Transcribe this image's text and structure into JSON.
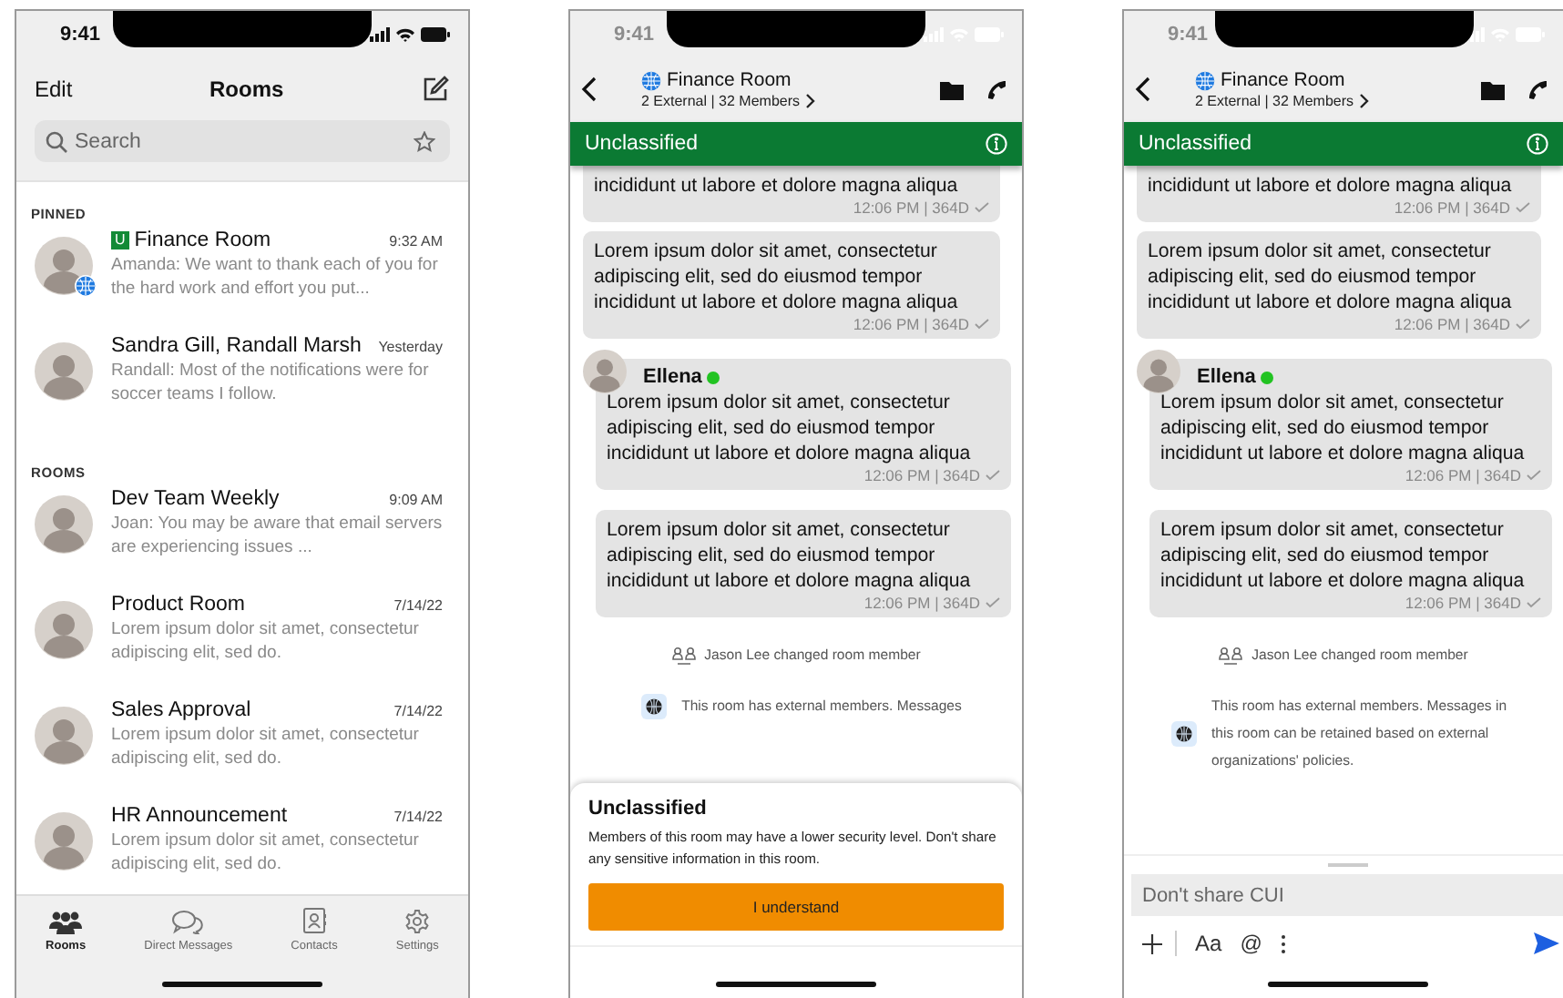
{
  "screens": [
    {
      "kind": "rooms",
      "status_time": "9:41",
      "edit_label": "Edit",
      "title": "Rooms",
      "search": {
        "placeholder": "Search"
      },
      "sections": [
        {
          "heading": "PINNED",
          "rooms": [
            {
              "name": "Finance Room",
              "badge": "U",
              "external": true,
              "time": "9:32 AM",
              "preview": "Amanda: We want to thank each of you for the hard work and effort you put..."
            },
            {
              "name": "Sandra Gill, Randall Marsh",
              "external": false,
              "time": "Yesterday",
              "preview": "Randall: Most of the notifications were for soccer teams I follow."
            }
          ]
        },
        {
          "heading": "ROOMS",
          "rooms": [
            {
              "name": "Dev Team Weekly",
              "external": false,
              "time": "9:09 AM",
              "preview": "Joan: You may be aware that email servers are experiencing issues ..."
            },
            {
              "name": "Product Room",
              "external": false,
              "time": "7/14/22",
              "preview": "Lorem ipsum dolor sit amet, consectetur adipiscing elit, sed do."
            },
            {
              "name": "Sales Approval",
              "external": false,
              "time": "7/14/22",
              "preview": "Lorem ipsum dolor sit amet, consectetur adipiscing elit, sed do."
            },
            {
              "name": "HR Announcement",
              "external": false,
              "time": "7/14/22",
              "preview": "Lorem ipsum dolor sit amet, consectetur adipiscing elit, sed do."
            }
          ]
        }
      ],
      "tabs": [
        {
          "label": "Rooms",
          "selected": true
        },
        {
          "label": "Direct Messages",
          "selected": false
        },
        {
          "label": "Contacts",
          "selected": false
        },
        {
          "label": "Settings",
          "selected": false
        }
      ]
    },
    {
      "kind": "chat",
      "status_time": "9:41",
      "room_title": "Finance Room",
      "room_subtitle": "2 External | 32 Members",
      "banner": "Unclassified",
      "messages": [
        {
          "kind": "plain",
          "text": "incididunt ut labore et dolore magna aliqua",
          "meta": "12:06 PM | 364D"
        },
        {
          "kind": "plain",
          "text": "Lorem ipsum dolor sit amet, consectetur adipiscing elit, sed do eiusmod tempor incididunt ut labore et dolore magna aliqua",
          "meta": "12:06 PM | 364D"
        },
        {
          "kind": "with_sender",
          "sender": "Ellena",
          "online": true,
          "text": "Lorem ipsum dolor sit amet, consectetur adipiscing elit, sed do eiusmod tempor incididunt ut labore et dolore magna aliqua",
          "meta": "12:06 PM | 364D"
        },
        {
          "kind": "follow",
          "text": "Lorem ipsum dolor sit amet, consectetur adipiscing elit, sed do eiusmod tempor incididunt ut labore et dolore magna aliqua",
          "meta": "12:06 PM | 364D"
        }
      ],
      "events": [
        {
          "kind": "member_change",
          "text": "Jason Lee changed room member"
        },
        {
          "kind": "external_notice",
          "text": "This room has external members. Messages"
        }
      ],
      "sheet": {
        "title": "Unclassified",
        "body": "Members of this room may have a lower security level. Don't share any sensitive information in this room.",
        "button": "I understand"
      }
    },
    {
      "kind": "chat",
      "status_time": "9:41",
      "room_title": "Finance Room",
      "room_subtitle": "2 External | 32 Members",
      "banner": "Unclassified",
      "messages": [
        {
          "kind": "plain",
          "text": "incididunt ut labore et dolore magna aliqua",
          "meta": "12:06 PM | 364D"
        },
        {
          "kind": "plain",
          "text": "Lorem ipsum dolor sit amet, consectetur adipiscing elit, sed do eiusmod tempor incididunt ut labore et dolore magna aliqua",
          "meta": "12:06 PM | 364D"
        },
        {
          "kind": "with_sender",
          "sender": "Ellena",
          "online": true,
          "text": "Lorem ipsum dolor sit amet, consectetur adipiscing elit, sed do eiusmod tempor incididunt ut labore et dolore magna aliqua",
          "meta": "12:06 PM | 364D"
        },
        {
          "kind": "follow",
          "text": "Lorem ipsum dolor sit amet, consectetur adipiscing elit, sed do eiusmod tempor incididunt ut labore et dolore magna aliqua",
          "meta": "12:06 PM | 364D"
        }
      ],
      "events": [
        {
          "kind": "member_change",
          "text": "Jason Lee changed room member"
        },
        {
          "kind": "external_notice",
          "text": "This room has external members. Messages in this room can be retained based on external organizations' policies."
        }
      ],
      "composer": {
        "placeholder": "Don't share CUI",
        "format_label": "Aa",
        "mention_label": "@"
      }
    }
  ]
}
